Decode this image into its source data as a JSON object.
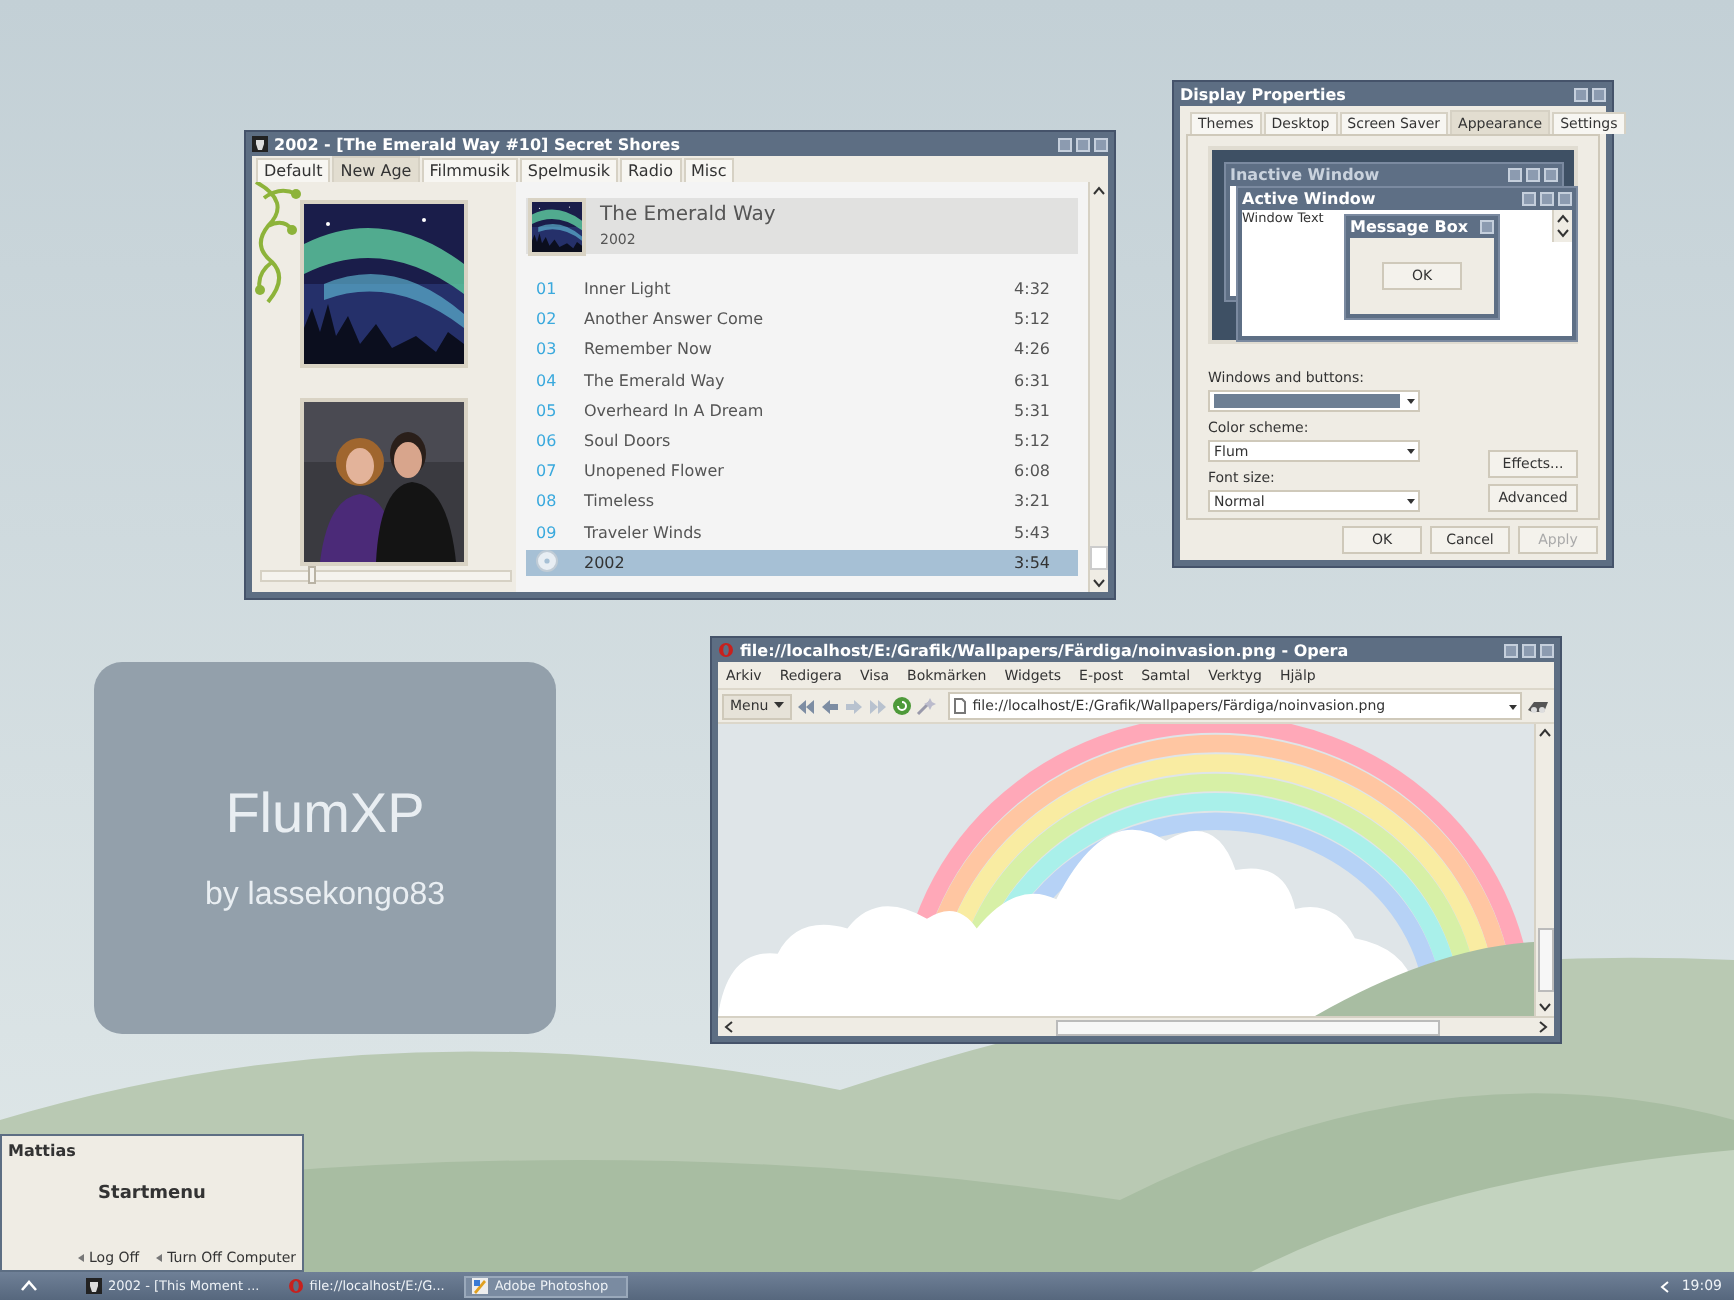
{
  "branding": {
    "title": "FlumXP",
    "subtitle": "by lassekongo83"
  },
  "music_player": {
    "title": "2002 - [The Emerald Way #10] Secret Shores",
    "tabs": [
      {
        "label": "Default",
        "selected": false
      },
      {
        "label": "New Age",
        "selected": true
      },
      {
        "label": "Filmmusik",
        "selected": false
      },
      {
        "label": "Spelmusik",
        "selected": false
      },
      {
        "label": "Radio",
        "selected": false
      },
      {
        "label": "Misc",
        "selected": false
      }
    ],
    "album": {
      "title": "The Emerald Way",
      "year": "2002"
    },
    "tracks": [
      {
        "number": "01",
        "title": "Inner Light",
        "duration": "4:32",
        "selected": false
      },
      {
        "number": "02",
        "title": "Another Answer Come",
        "duration": "5:12",
        "selected": false
      },
      {
        "number": "03",
        "title": "Remember Now",
        "duration": "4:26",
        "selected": false
      },
      {
        "number": "04",
        "title": "The Emerald Way",
        "duration": "6:31",
        "selected": false
      },
      {
        "number": "05",
        "title": "Overheard In A Dream",
        "duration": "5:31",
        "selected": false
      },
      {
        "number": "06",
        "title": "Soul Doors",
        "duration": "5:12",
        "selected": false
      },
      {
        "number": "07",
        "title": "Unopened Flower",
        "duration": "6:08",
        "selected": false
      },
      {
        "number": "08",
        "title": "Timeless",
        "duration": "3:21",
        "selected": false
      },
      {
        "number": "09",
        "title": "Traveler Winds",
        "duration": "5:43",
        "selected": false
      },
      {
        "title": "2002",
        "duration": "3:54",
        "selected": true
      }
    ],
    "seek": {
      "level": 0.2
    }
  },
  "display_properties": {
    "title": "Display Properties",
    "tabs": [
      {
        "label": "Themes",
        "selected": false
      },
      {
        "label": "Desktop",
        "selected": false
      },
      {
        "label": "Screen Saver",
        "selected": false
      },
      {
        "label": "Appearance",
        "selected": true
      },
      {
        "label": "Settings",
        "selected": false
      }
    ],
    "preview": {
      "inactive_title": "Inactive Window",
      "active_title": "Active Window",
      "window_text": "Window Text",
      "message_title": "Message Box",
      "message_button": "OK"
    },
    "fields": [
      {
        "label": "Windows and buttons:",
        "kind": "swatch"
      },
      {
        "label": "Color scheme:",
        "kind": "text",
        "value": "Flum"
      },
      {
        "label": "Font size:",
        "kind": "text",
        "value": "Normal"
      }
    ],
    "side_buttons": [
      {
        "label": "Effects...",
        "disabled": false
      },
      {
        "label": "Advanced",
        "disabled": false
      }
    ],
    "buttons": [
      {
        "label": "OK",
        "disabled": false
      },
      {
        "label": "Cancel",
        "disabled": false
      },
      {
        "label": "Apply",
        "disabled": true
      }
    ]
  },
  "browser": {
    "title": "file://localhost/E:/Grafik/Wallpapers/Färdiga/noinvasion.png - Opera",
    "menu": [
      "Arkiv",
      "Redigera",
      "Visa",
      "Bokmärken",
      "Widgets",
      "E-post",
      "Samtal",
      "Verktyg",
      "Hjälp"
    ],
    "menu_button": "Menu",
    "address": "file://localhost/E:/Grafik/Wallpapers/Färdiga/noinvasion.png",
    "content": {
      "kind": "picture"
    }
  },
  "start_menu": {
    "user": "Mattias",
    "title": "Startmenu",
    "actions": [
      "Log Off",
      "Turn Off Computer"
    ]
  },
  "taskbar": {
    "items": [
      {
        "label": "2002 - [This Moment ...",
        "kind": "player",
        "selected": false
      },
      {
        "label": "file://localhost/E:/G...",
        "kind": "opera",
        "selected": false
      },
      {
        "label": "Adobe Photoshop",
        "kind": "photoshop",
        "selected": true
      }
    ],
    "clock": "19:09"
  }
}
